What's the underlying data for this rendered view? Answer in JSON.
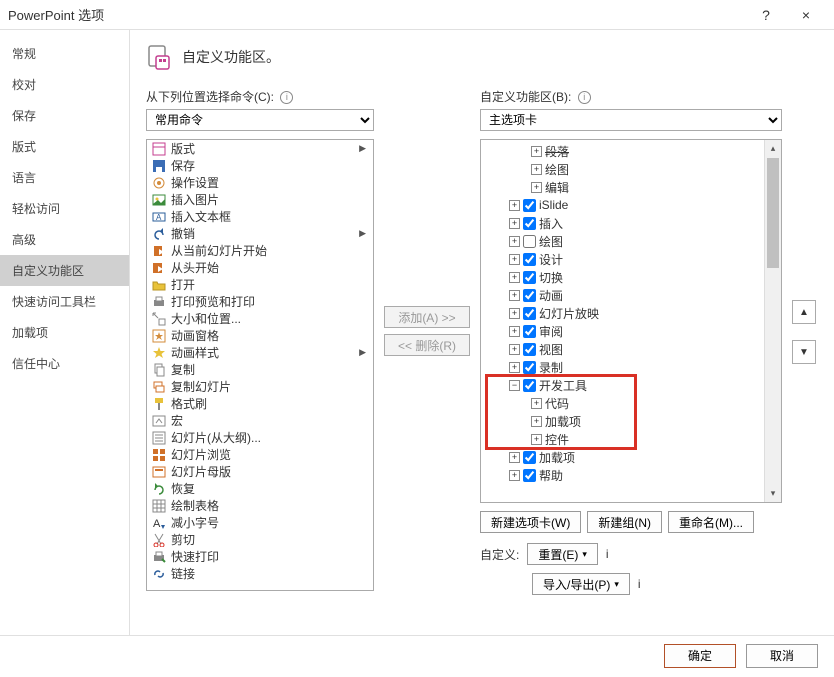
{
  "window": {
    "title": "PowerPoint 选项",
    "help": "?",
    "close": "×"
  },
  "sidebar": {
    "items": [
      {
        "label": "常规"
      },
      {
        "label": "校对"
      },
      {
        "label": "保存"
      },
      {
        "label": "版式"
      },
      {
        "label": "语言"
      },
      {
        "label": "轻松访问"
      },
      {
        "label": "高级"
      },
      {
        "label": "自定义功能区",
        "selected": true
      },
      {
        "label": "快速访问工具栏"
      },
      {
        "label": "加载项"
      },
      {
        "label": "信任中心"
      }
    ]
  },
  "page": {
    "title": "自定义功能区。"
  },
  "left": {
    "label": "从下列位置选择命令(C):",
    "combo": "常用命令"
  },
  "right": {
    "label": "自定义功能区(B):",
    "combo": "主选项卡"
  },
  "mid": {
    "add": "添加(A) >>",
    "remove": "<< 删除(R)"
  },
  "commands": [
    {
      "icon": "layout",
      "label": "版式",
      "expand": true
    },
    {
      "icon": "save",
      "label": "保存"
    },
    {
      "icon": "action",
      "label": "操作设置"
    },
    {
      "icon": "picture",
      "label": "插入图片"
    },
    {
      "icon": "textbox",
      "label": "插入文本框"
    },
    {
      "icon": "undo",
      "label": "撤销",
      "expand": true
    },
    {
      "icon": "fromcurrent",
      "label": "从当前幻灯片开始"
    },
    {
      "icon": "frombeginning",
      "label": "从头开始"
    },
    {
      "icon": "open",
      "label": "打开"
    },
    {
      "icon": "printpreview",
      "label": "打印预览和打印"
    },
    {
      "icon": "sizepos",
      "label": "大小和位置..."
    },
    {
      "icon": "animpane",
      "label": "动画窗格"
    },
    {
      "icon": "animstyle",
      "label": "动画样式",
      "expand": true
    },
    {
      "icon": "copy",
      "label": "复制"
    },
    {
      "icon": "dupslide",
      "label": "复制幻灯片"
    },
    {
      "icon": "formatpainter",
      "label": "格式刷"
    },
    {
      "icon": "macro",
      "label": "宏"
    },
    {
      "icon": "outline",
      "label": "幻灯片(从大纲)..."
    },
    {
      "icon": "slideview",
      "label": "幻灯片浏览"
    },
    {
      "icon": "master",
      "label": "幻灯片母版"
    },
    {
      "icon": "restore",
      "label": "恢复"
    },
    {
      "icon": "drawtable",
      "label": "绘制表格"
    },
    {
      "icon": "fontdown",
      "label": "减小字号"
    },
    {
      "icon": "cut",
      "label": "剪切"
    },
    {
      "icon": "quickprint",
      "label": "快速打印"
    },
    {
      "icon": "link",
      "label": "链接"
    }
  ],
  "tree": [
    {
      "indent": 4,
      "toggle": "plus",
      "label": "段落",
      "strike": true
    },
    {
      "indent": 4,
      "toggle": "plus",
      "label": "绘图"
    },
    {
      "indent": 4,
      "toggle": "plus",
      "label": "编辑"
    },
    {
      "indent": 2,
      "toggle": "plus",
      "checkbox": true,
      "label": "iSlide"
    },
    {
      "indent": 2,
      "toggle": "plus",
      "checkbox": true,
      "label": "插入"
    },
    {
      "indent": 2,
      "toggle": "plus",
      "checkbox": false,
      "label": "绘图"
    },
    {
      "indent": 2,
      "toggle": "plus",
      "checkbox": true,
      "label": "设计"
    },
    {
      "indent": 2,
      "toggle": "plus",
      "checkbox": true,
      "label": "切换"
    },
    {
      "indent": 2,
      "toggle": "plus",
      "checkbox": true,
      "label": "动画"
    },
    {
      "indent": 2,
      "toggle": "plus",
      "checkbox": true,
      "label": "幻灯片放映"
    },
    {
      "indent": 2,
      "toggle": "plus",
      "checkbox": true,
      "label": "审阅"
    },
    {
      "indent": 2,
      "toggle": "plus",
      "checkbox": true,
      "label": "视图"
    },
    {
      "indent": 2,
      "toggle": "plus",
      "checkbox": true,
      "label": "录制"
    },
    {
      "indent": 2,
      "toggle": "minus",
      "checkbox": true,
      "label": "开发工具",
      "highlight": "start"
    },
    {
      "indent": 4,
      "toggle": "plus",
      "label": "代码"
    },
    {
      "indent": 4,
      "toggle": "plus",
      "label": "加载项"
    },
    {
      "indent": 4,
      "toggle": "plus",
      "label": "控件",
      "highlight": "end"
    },
    {
      "indent": 2,
      "toggle": "plus",
      "checkbox": true,
      "label": "加载项"
    },
    {
      "indent": 2,
      "toggle": "plus",
      "checkbox": true,
      "label": "帮助"
    }
  ],
  "below": {
    "new_tab": "新建选项卡(W)",
    "new_group": "新建组(N)",
    "rename": "重命名(M)...",
    "customize_label": "自定义:",
    "reset": "重置(E)",
    "importexport": "导入/导出(P)"
  },
  "updown": {
    "up": "▲",
    "down": "▼"
  },
  "footer": {
    "ok": "确定",
    "cancel": "取消"
  }
}
